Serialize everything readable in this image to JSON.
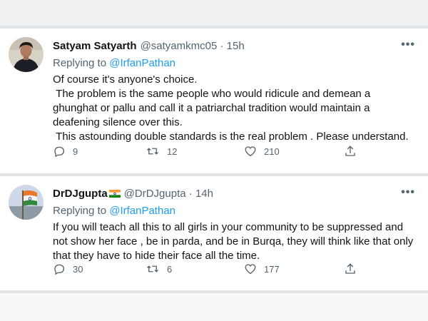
{
  "tweets": [
    {
      "name": "Satyam Satyarth",
      "handle": "@satyamkmc05",
      "time": "15h",
      "replying_prefix": "Replying to ",
      "replying_to": "@IrfanPathan",
      "body": [
        "Of course it's anyone's choice.",
        " The problem is the same people who would ridicule and demean a ghunghat or pallu and call it a patriarchal tradition would maintain a deafening silence over this.",
        " This astounding double standards is the real problem . Please understand."
      ],
      "replies": "9",
      "retweets": "12",
      "likes": "210"
    },
    {
      "name": "DrDJgupta",
      "handle": "@DrDJgupta",
      "time": "14h",
      "replying_prefix": "Replying to ",
      "replying_to": "@IrfanPathan",
      "body": [
        "If you will teach all this to all girls in your community to be suppressed and not show her face , be in parda, and be in Burqa, they will think like that only that they have to hide their face all the time."
      ],
      "replies": "30",
      "retweets": "6",
      "likes": "177"
    }
  ],
  "icons": {
    "reply": "reply-icon",
    "retweet": "retweet-icon",
    "like": "heart-icon",
    "share": "share-icon",
    "more": "more-icon"
  },
  "colors": {
    "accent": "#1d9bf0",
    "secondary_text": "#536471",
    "primary_text": "#0f1419"
  },
  "more_glyph": "•••",
  "separator": "·"
}
